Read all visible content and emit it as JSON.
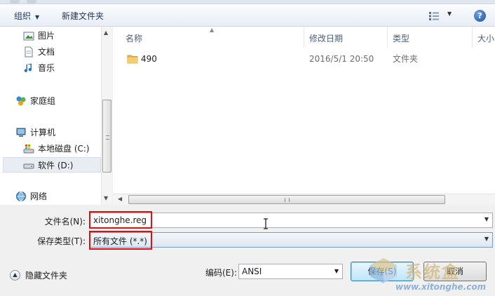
{
  "toolbar": {
    "organize": "组织",
    "new_folder": "新建文件夹",
    "help": "?"
  },
  "nav": {
    "items": [
      {
        "label": "图片",
        "icon": "pictures-icon"
      },
      {
        "label": "文档",
        "icon": "documents-icon"
      },
      {
        "label": "音乐",
        "icon": "music-icon"
      },
      {
        "label": "家庭组",
        "icon": "homegroup-icon"
      },
      {
        "label": "计算机",
        "icon": "computer-icon"
      },
      {
        "label": "本地磁盘 (C:)",
        "icon": "drive-c-icon"
      },
      {
        "label": "软件 (D:)",
        "icon": "drive-d-icon",
        "selected": true
      },
      {
        "label": "网络",
        "icon": "network-icon"
      }
    ]
  },
  "columns": {
    "name": "名称",
    "modified": "修改日期",
    "type": "类型",
    "size": "大小"
  },
  "files": [
    {
      "name": "490",
      "modified": "2016/5/1 20:50",
      "type": "文件夹",
      "icon": "folder-icon"
    }
  ],
  "form": {
    "filename_label": "文件名(N):",
    "filename_value": "xitonghe.reg",
    "filetype_label": "保存类型(T):",
    "filetype_value": "所有文件  (*.*)",
    "encoding_label": "编码(E):",
    "encoding_value": "ANSI"
  },
  "footer": {
    "hide_folders": "隐藏文件夹",
    "save": "保存(S)",
    "cancel": "取消"
  },
  "watermark": {
    "brand": "系统盒",
    "url": "www.xitonghe.com"
  },
  "colors": {
    "highlight_box": "#e01010",
    "primary_button": "#bee6fd",
    "selection": "#e8ecf3"
  }
}
